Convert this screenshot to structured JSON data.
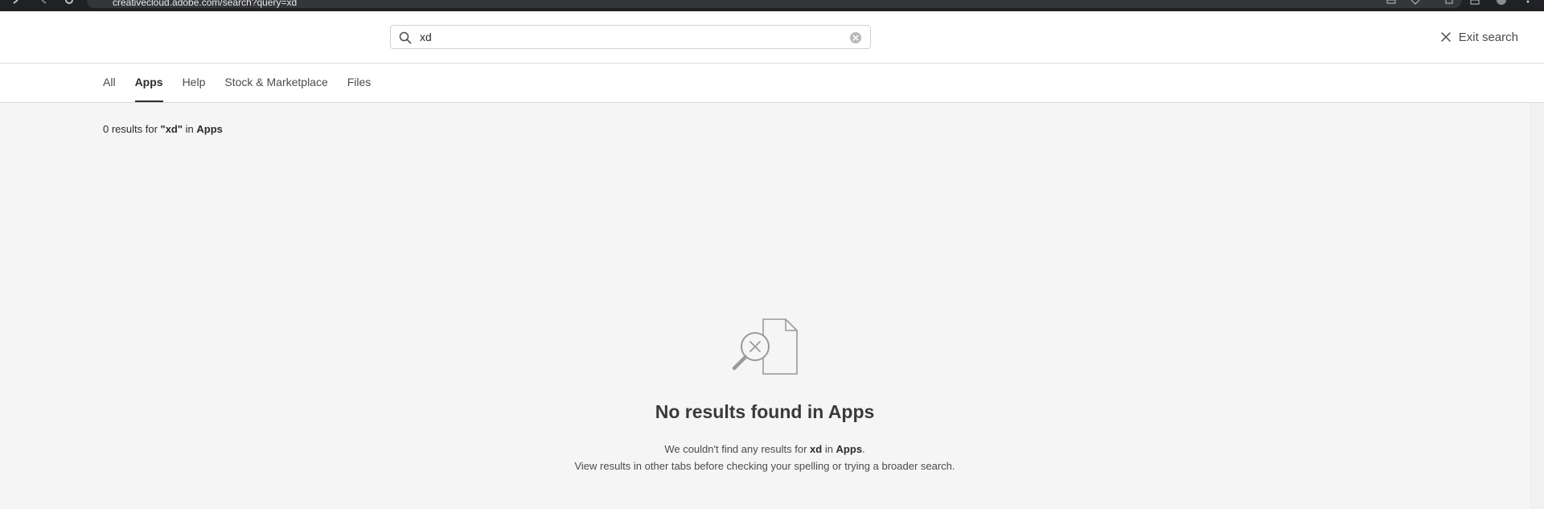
{
  "browser": {
    "url": "creativecloud.adobe.com/search?query=xd"
  },
  "search": {
    "value": "xd",
    "exit_label": "Exit search"
  },
  "tabs": [
    {
      "label": "All",
      "active": false
    },
    {
      "label": "Apps",
      "active": true
    },
    {
      "label": "Help",
      "active": false
    },
    {
      "label": "Stock & Marketplace",
      "active": false
    },
    {
      "label": "Files",
      "active": false
    }
  ],
  "summary": {
    "prefix": "0 results for ",
    "query": "\"xd\"",
    "middle": " in ",
    "scope": "Apps"
  },
  "empty_state": {
    "title": "No results found in Apps",
    "line1_prefix": "We couldn't find any results for ",
    "line1_query": "xd",
    "line1_middle": " in ",
    "line1_scope": "Apps",
    "line1_suffix": ".",
    "line2": "View results in other tabs before checking your spelling or trying a broader search."
  },
  "colors": {
    "accent": "#2c2c2c",
    "background": "#f5f5f5",
    "browser_chrome": "#202124"
  }
}
